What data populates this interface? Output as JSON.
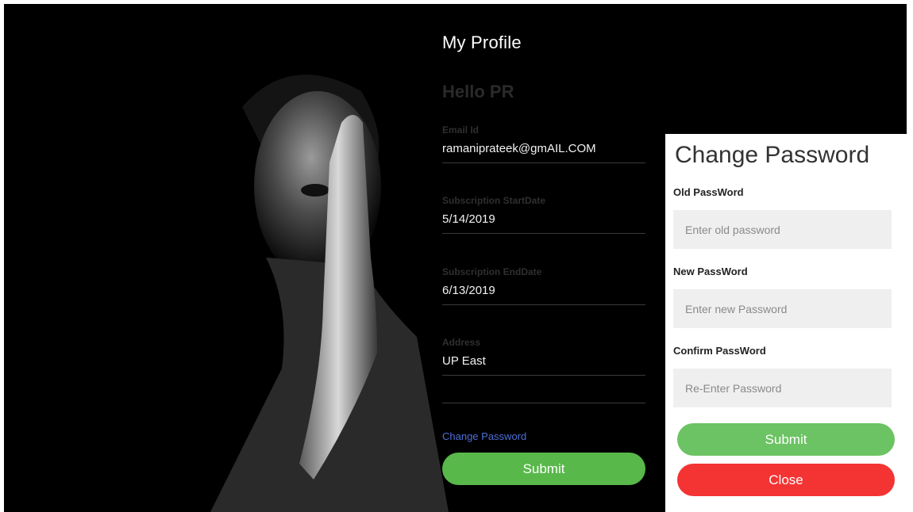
{
  "profile": {
    "title": "My Profile",
    "greeting": "Hello PR",
    "fields": [
      {
        "label": "Email Id",
        "value": "ramaniprateek@gmAIL.COM"
      },
      {
        "label": "Subscription StartDate",
        "value": "5/14/2019"
      },
      {
        "label": "Subscription EndDate",
        "value": "6/13/2019"
      },
      {
        "label": "Address",
        "value": "UP East"
      }
    ],
    "change_password_link": "Change Password",
    "submit_label": "Submit"
  },
  "change_password": {
    "title": "Change Password",
    "old": {
      "label": "Old PassWord",
      "placeholder": "Enter old password"
    },
    "new": {
      "label": "New PassWord",
      "placeholder": "Enter new Password"
    },
    "confirm": {
      "label": "Confirm PassWord",
      "placeholder": "Re-Enter Password"
    },
    "submit_label": "Submit",
    "close_label": "Close"
  },
  "colors": {
    "background": "#000000",
    "submit_green": "#58b84a",
    "close_red": "#f43333",
    "link_blue": "#4d6fd6"
  }
}
